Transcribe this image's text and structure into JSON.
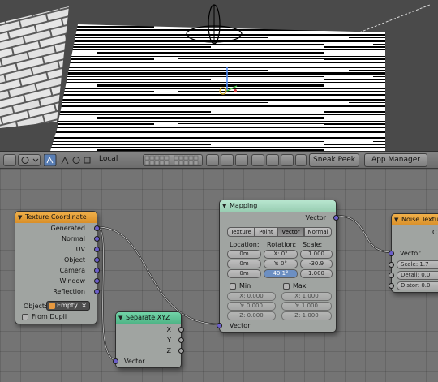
{
  "viewport_header": {
    "orientation_value": "Local",
    "sneak_peek_label": "Sneak Peek",
    "app_manager_label": "App Manager"
  },
  "nodes": {
    "texture_coordinate": {
      "title": "Texture Coordinate",
      "outputs": [
        "Generated",
        "Normal",
        "UV",
        "Object",
        "Camera",
        "Window",
        "Reflection"
      ],
      "object_label": "Object:",
      "object_value": "Empty",
      "from_dupli_label": "From Dupli",
      "header_color": "#e8a33a"
    },
    "separate_xyz": {
      "title": "Separate XYZ",
      "outputs": [
        "X",
        "Y",
        "Z"
      ],
      "input_label": "Vector",
      "header_color": "#5fc69a"
    },
    "mapping": {
      "title": "Mapping",
      "output_label": "Vector",
      "types": [
        "Texture",
        "Point",
        "Vector",
        "Normal"
      ],
      "active_type": "Vector",
      "location_label": "Location:",
      "rotation_label": "Rotation:",
      "scale_label": "Scale:",
      "location": [
        "0m",
        "0m",
        "0m"
      ],
      "rotation": [
        "X: 0°",
        "Y: 0°",
        "40.1°"
      ],
      "scale": [
        "1.000",
        "-30.9",
        "1.000"
      ],
      "min_label": "Min",
      "max_label": "Max",
      "min": [
        "X: 0.000",
        "Y: 0.000",
        "Z: 0.000"
      ],
      "max": [
        "X: 1.000",
        "Y: 1.000",
        "Z: 1.000"
      ],
      "input_label": "Vector",
      "header_color": "#a6d9bf"
    },
    "noise_texture": {
      "title": "Noise Texture",
      "output_partial": "C",
      "input_label": "Vector",
      "scale_field": "Scale: 1.7",
      "detail_field": "Detail: 0.0",
      "distortion_field": "Distor: 0.0",
      "header_color": "#e8a33a"
    }
  },
  "colors": {
    "vector_socket": "#6c5fc9",
    "float_socket": "#a1a1a1",
    "node_body": "#a0a4a1",
    "grid_background": "#747474"
  }
}
